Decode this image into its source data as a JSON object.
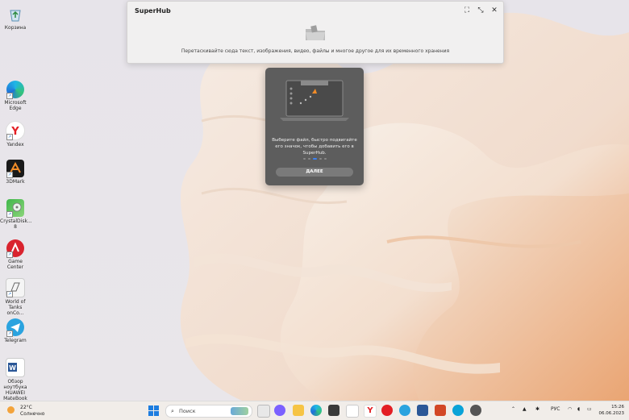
{
  "desktop": {
    "icons": [
      {
        "label": "Корзина",
        "icon": "recycle-bin-icon"
      },
      {
        "label": "Microsoft Edge",
        "icon": "edge-icon"
      },
      {
        "label": "Yandex",
        "icon": "yandex-browser-icon"
      },
      {
        "label": "3DMark",
        "icon": "3dmark-icon"
      },
      {
        "label": "CrystalDisk... 8",
        "icon": "crystaldisk-icon"
      },
      {
        "label": "Game Center",
        "icon": "game-center-icon"
      },
      {
        "label": "World of Tanks onCo...",
        "icon": "wot-icon"
      },
      {
        "label": "Telegram",
        "icon": "telegram-icon"
      },
      {
        "label": "Обзор ноутбука HUAWEI MateBook D...",
        "icon": "word-doc-icon"
      }
    ]
  },
  "superhub": {
    "title": "SuperHub",
    "hint": "Перетаскивайте сюда текст, изображения, видео, файлы и многое другое для их временного хранения"
  },
  "onboarding": {
    "text": "Выберите файл, быстро подвигайте его значок, чтобы добавить его в SuperHub.",
    "button": "ДАЛЕЕ",
    "step_count": 5,
    "active_step": 3
  },
  "taskbar": {
    "weather_temp": "22°C",
    "weather_desc": "Солнечно",
    "search_placeholder": "Поиск",
    "language": "РУС",
    "time": "15:26",
    "date": "06.06.2023"
  },
  "colors": {
    "accent": "#3b82f6",
    "popup_bg": "#5d5d5d",
    "taskbar_bg": "#f1ede9"
  }
}
